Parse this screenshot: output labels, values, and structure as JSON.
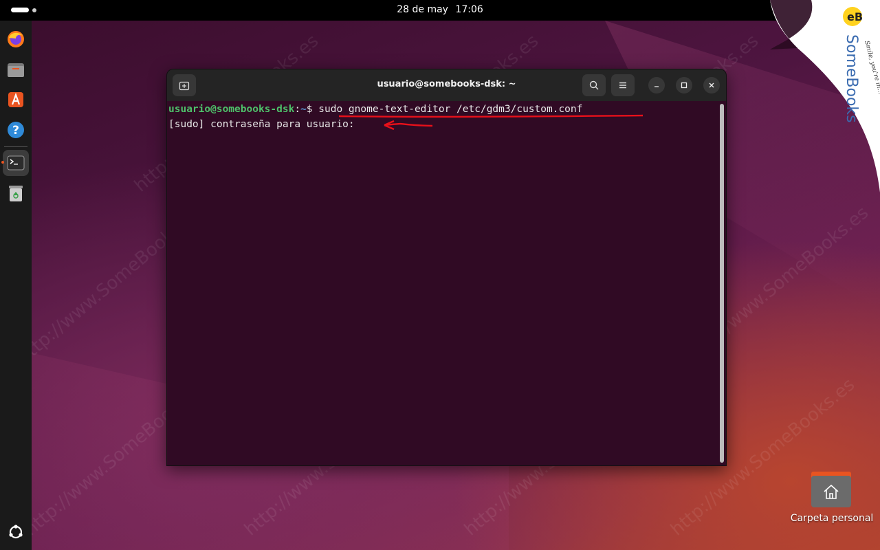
{
  "topbar": {
    "date": "28 de may",
    "time": "17:06"
  },
  "dock": {
    "items": [
      {
        "name": "firefox-icon"
      },
      {
        "name": "files-icon"
      },
      {
        "name": "app-center-icon"
      },
      {
        "name": "help-icon"
      },
      {
        "name": "terminal-icon",
        "active": true
      },
      {
        "name": "trash-icon"
      }
    ],
    "apps_grid": "show-apps-icon"
  },
  "terminal": {
    "title": "usuario@somebooks-dsk: ~",
    "prompt_user": "usuario@somebooks-dsk",
    "prompt_colon": ":",
    "prompt_path": "~",
    "prompt_symbol": "$ ",
    "command": "sudo gnome-text-editor /etc/gdm3/custom.conf",
    "output_line": "[sudo] contraseña para usuario: ",
    "colors": {
      "background": "#300a24",
      "user": "#4ec16a",
      "path": "#5d9ad4",
      "annotation": "#e8101a"
    }
  },
  "desktop": {
    "home_label": "Carpeta personal"
  },
  "watermark": {
    "text": "http://www.SomeBooks.es"
  },
  "badge": {
    "brand": "SomeBooks",
    "tagline": "Smile, you're in..."
  }
}
